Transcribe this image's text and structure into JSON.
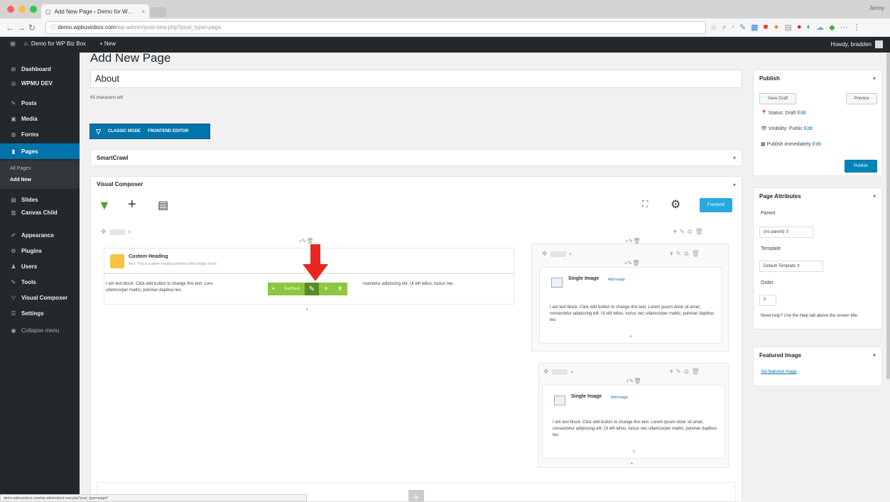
{
  "browser": {
    "tab_title": "Add New Page ‹ Demo for W…",
    "url_host": "demo.wpbusinbox.com",
    "url_path": "/wp-admin/post-new.php?post_type=page",
    "user_label": "Jenny"
  },
  "adminbar": {
    "site_name": "Demo for WP Biz Box",
    "new_label": "+ New",
    "howdy": "Howdy, bradden"
  },
  "sidebar": {
    "items": [
      {
        "icon": "dashboard-icon",
        "glyph": "⊞",
        "label": "Dashboard"
      },
      {
        "icon": "wpmudev-icon",
        "glyph": "◎",
        "label": "WPMU DEV"
      },
      {
        "icon": "posts-icon",
        "glyph": "✎",
        "label": "Posts"
      },
      {
        "icon": "media-icon",
        "glyph": "▣",
        "label": "Media"
      },
      {
        "icon": "forms-icon",
        "glyph": "◍",
        "label": "Forms"
      },
      {
        "icon": "pages-icon",
        "glyph": "▮",
        "label": "Pages"
      },
      {
        "icon": "slides-icon",
        "glyph": "▤",
        "label": "Slides"
      },
      {
        "icon": "canvas-child-icon",
        "glyph": "▥",
        "label": "Canvas Child"
      },
      {
        "icon": "appearance-icon",
        "glyph": "✐",
        "label": "Appearance"
      },
      {
        "icon": "plugins-icon",
        "glyph": "⚙",
        "label": "Plugins"
      },
      {
        "icon": "users-icon",
        "glyph": "♟",
        "label": "Users"
      },
      {
        "icon": "tools-icon",
        "glyph": "✎",
        "label": "Tools"
      },
      {
        "icon": "visual-composer-icon",
        "glyph": "▽",
        "label": "Visual Composer"
      },
      {
        "icon": "settings-icon",
        "glyph": "☰",
        "label": "Settings"
      },
      {
        "icon": "collapse-icon",
        "glyph": "◉",
        "label": "Collapse menu"
      }
    ],
    "submenu": [
      "All Pages",
      "Add New"
    ]
  },
  "editor": {
    "heading": "Add New Page",
    "title_value": "About",
    "char_count": "65 characters left",
    "classic_mode": "CLASSIC MODE",
    "frontend_editor": "FRONTEND EDITOR",
    "smartcrawl_title": "SmartCrawl",
    "vc_title": "Visual Composer",
    "frontend_button": "Frontend"
  },
  "vc_content": {
    "custom_heading_name": "Custom Heading",
    "custom_heading_sub": "Text: This is custom heading element with Google Fonts",
    "text_block": "I am text block. Click edit button to change this text. Lorem ipsum dolor sit amet, consectetur adipiscing elit. Ut elit tellus, luctus nec ullamcorper mattis, pulvinar dapibus leo.",
    "text_block_visible_left": "I am text block. Click edit button to change this text. Lore",
    "text_block_visible_right": "nsectetur adipiscing elit. Ut elit tellus, luctus nec",
    "text_block_line2": "ullamcorper mattis, pulvinar dapibus leo.",
    "single_image_name": "Single Image",
    "add_image_label": "Add image",
    "toolbar_label": "Text Block",
    "right_text": "I am text block. Click edit button to change this text. Lorem ipsum dolor sit amet, consectetur adipiscing elit. Ut elit tellus, luctus nec ullamcorper mattis, pulvinar dapibus leo."
  },
  "publish": {
    "title": "Publish",
    "save_draft": "Save Draft",
    "preview": "Preview",
    "status_label": "Status: Draft",
    "visibility_label": "Visibility: Public",
    "publish_time_label": "Publish immediately",
    "edit_link": "Edit",
    "publish_button": "Publish"
  },
  "attributes": {
    "title": "Page Attributes",
    "parent_label": "Parent",
    "parent_value": "(no parent) ⇕",
    "template_label": "Template",
    "template_value": "Default Template ⇕",
    "order_label": "Order",
    "order_value": "0",
    "help_text": "Need help? Use the Help tab above the screen title."
  },
  "featured": {
    "title": "Featured Image",
    "set_link": "Set featured image"
  },
  "status_bar": "demo.wpbusinbox.com/wp-admin/post-new.php?post_type=page#",
  "colors": {
    "admin_dark": "#23282d",
    "wp_blue": "#0073aa",
    "vc_green": "#8dc63f",
    "arrow_red": "#e8261f"
  }
}
